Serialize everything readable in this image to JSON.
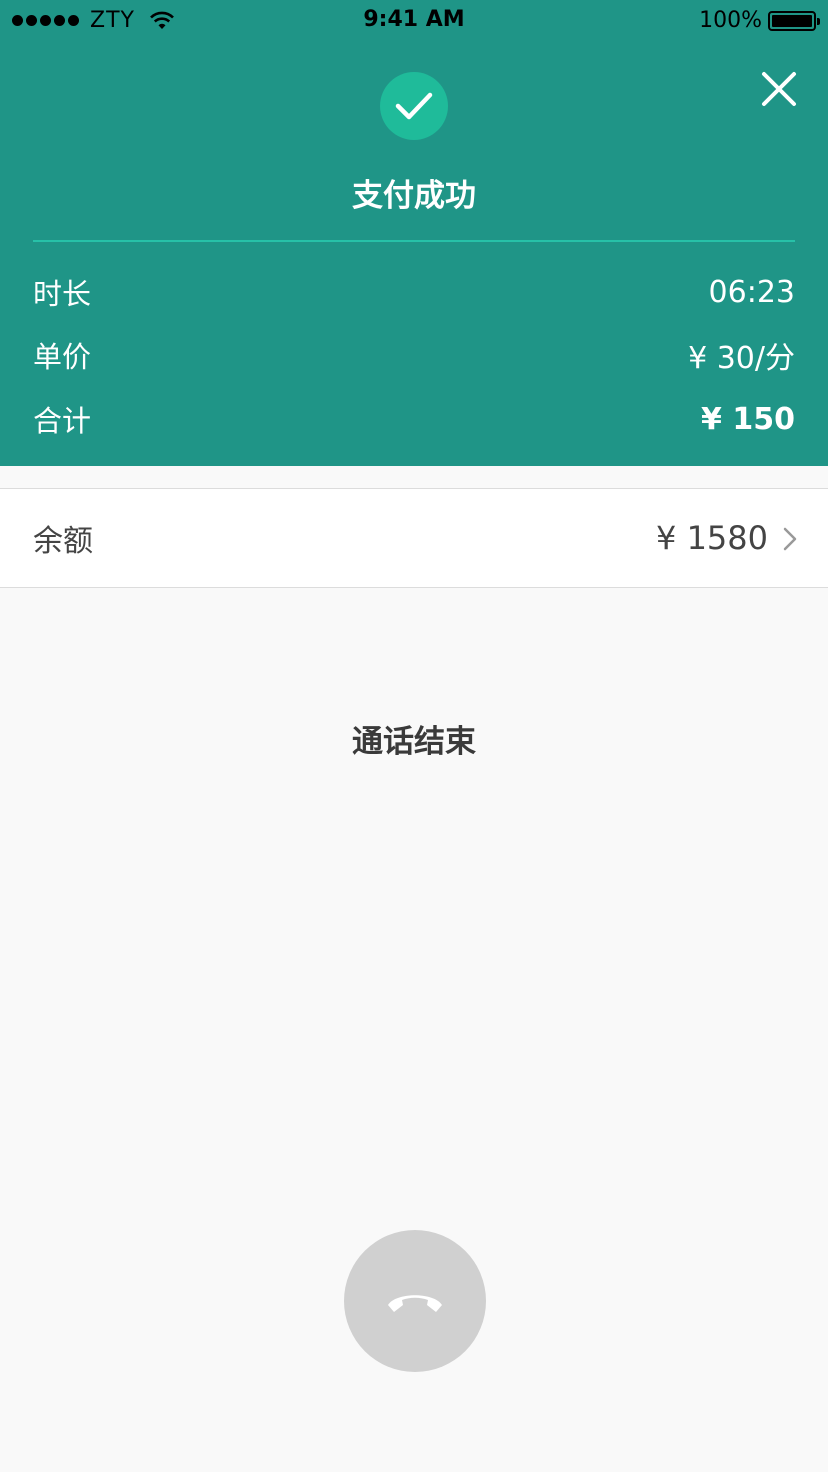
{
  "status_bar": {
    "carrier": "ZTY",
    "time": "9:41 AM",
    "battery": "100%",
    "battery_level": 1.0
  },
  "header": {
    "title": "支付成功",
    "success_icon": "check-icon",
    "close_icon": "close-icon",
    "rows": [
      {
        "label": "时长",
        "value": "06:23"
      },
      {
        "label": "单价",
        "value": "¥ 30/分"
      },
      {
        "label": "合计",
        "value": "¥ 150"
      }
    ]
  },
  "balance": {
    "label": "余额",
    "value": "¥ 1580",
    "icon": "chevron-right-icon"
  },
  "call_status": "通话结束",
  "hangup_icon": "phone-hangup-icon",
  "colors": {
    "header_bg": "#1f9587",
    "success_circle": "#1fbb9a",
    "divider": "#27c1a8",
    "hangup_button": "#d0d0d0",
    "page_bg": "#f9f9f9"
  }
}
